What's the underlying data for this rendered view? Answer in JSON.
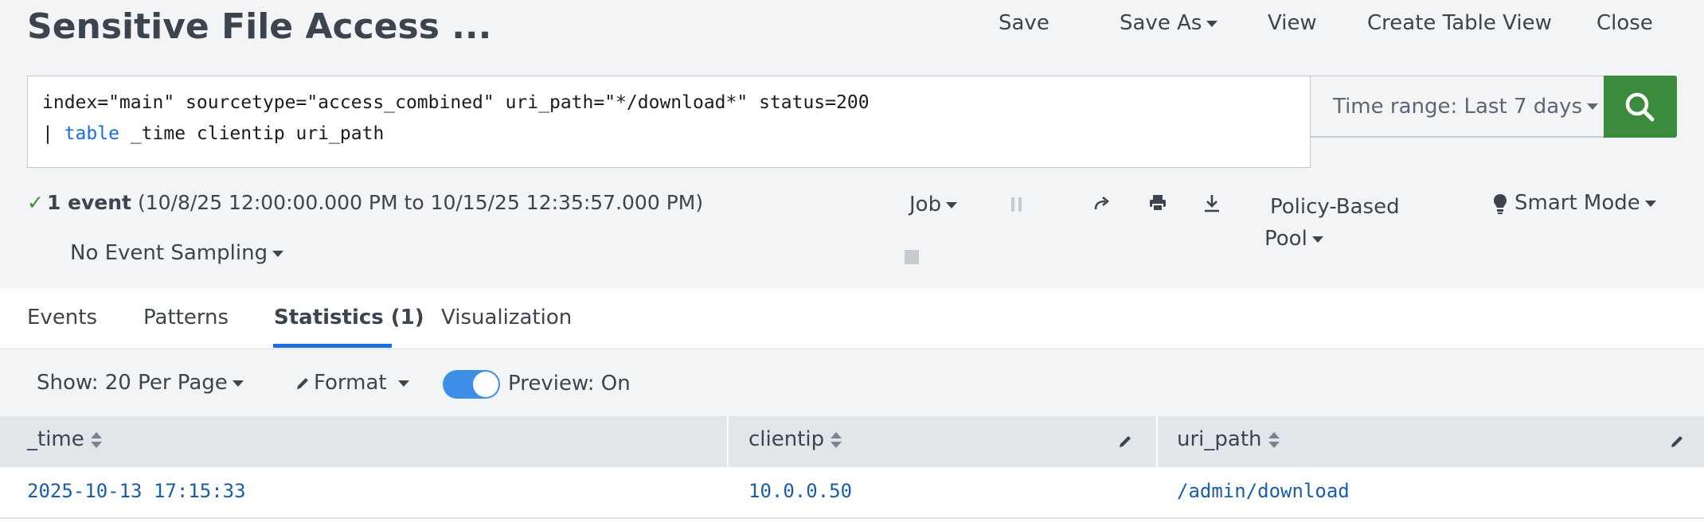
{
  "header": {
    "title": "Sensitive File Access ...",
    "save": "Save",
    "save_as": "Save As",
    "view": "View",
    "create_table_view": "Create Table View",
    "close": "Close"
  },
  "search": {
    "line1": "index=\"main\" sourcetype=\"access_combined\" uri_path=\"*/download*\" status=200",
    "line2_pipe": "| ",
    "line2_command": "table",
    "line2_rest": " _time clientip uri_path",
    "time_range": "Time range: Last 7 days",
    "search_icon": "search-icon"
  },
  "status": {
    "event_count": "1 event",
    "range": "(10/8/25 12:00:00.000 PM to 10/15/25 12:35:57.000 PM)",
    "sampling": "No Event Sampling"
  },
  "job_controls": {
    "job": "Job",
    "pool_line1": "Policy-Based",
    "pool_line2": "Pool",
    "mode": "Smart Mode",
    "icons": [
      "pause-icon",
      "stop-icon",
      "share-icon",
      "print-icon",
      "download-icon",
      "lightbulb-icon"
    ]
  },
  "tabs": [
    {
      "label": "Events"
    },
    {
      "label": "Patterns"
    },
    {
      "label": "Statistics (1)",
      "active": true
    },
    {
      "label": "Visualization"
    }
  ],
  "toolbar": {
    "show": "Show: 20 Per Page",
    "format": "Format",
    "preview": "Preview: On",
    "preview_on": true
  },
  "table": {
    "columns": [
      "_time",
      "clientip",
      "uri_path"
    ],
    "rows": [
      [
        "2025-10-13 17:15:33",
        "10.0.0.50",
        "/admin/download"
      ]
    ]
  },
  "colors": {
    "accent": "#1a6ee0",
    "search_button": "#3c8a3e",
    "link": "#1a5ea8",
    "success": "#3c8a3e"
  }
}
